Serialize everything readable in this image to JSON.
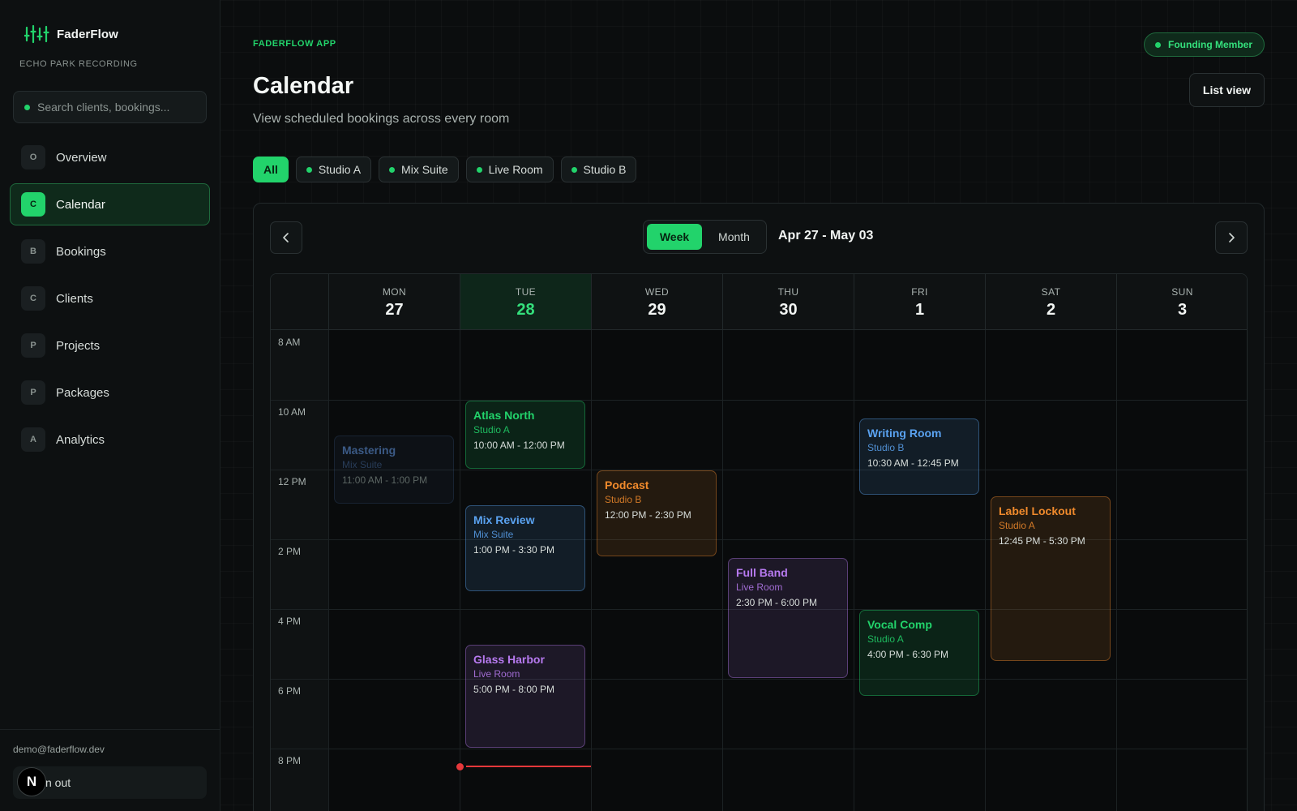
{
  "sidebar": {
    "brand": "FaderFlow",
    "studio": "ECHO PARK RECORDING",
    "search_placeholder": "Search clients, bookings...",
    "items": [
      {
        "badge": "O",
        "label": "Overview"
      },
      {
        "badge": "C",
        "label": "Calendar",
        "active": true
      },
      {
        "badge": "B",
        "label": "Bookings"
      },
      {
        "badge": "C",
        "label": "Clients"
      },
      {
        "badge": "P",
        "label": "Projects"
      },
      {
        "badge": "P",
        "label": "Packages"
      },
      {
        "badge": "A",
        "label": "Analytics"
      }
    ],
    "email": "demo@faderflow.dev",
    "signout": "n out",
    "avatar": "N"
  },
  "header": {
    "eyebrow": "FADERFLOW APP",
    "member_badge": "Founding Member",
    "title": "Calendar",
    "subtitle": "View scheduled bookings across every room",
    "list_view": "List view"
  },
  "filters": [
    "All",
    "Studio A",
    "Mix Suite",
    "Live Room",
    "Studio B"
  ],
  "calendar": {
    "view_week": "Week",
    "view_month": "Month",
    "range": "Apr 27 - May 03",
    "days": [
      {
        "dow": "MON",
        "num": "27"
      },
      {
        "dow": "TUE",
        "num": "28",
        "today": true
      },
      {
        "dow": "WED",
        "num": "29"
      },
      {
        "dow": "THU",
        "num": "30"
      },
      {
        "dow": "FRI",
        "num": "1"
      },
      {
        "dow": "SAT",
        "num": "2"
      },
      {
        "dow": "SUN",
        "num": "3"
      }
    ],
    "hours": [
      "8 AM",
      "10 AM",
      "12 PM",
      "2 PM",
      "4 PM",
      "6 PM",
      "8 PM"
    ],
    "events": [
      {
        "title": "Mastering",
        "room": "Mix Suite",
        "time": "11:00 AM - 1:00 PM",
        "day": 0,
        "start": 11,
        "end": 13,
        "color": "#3b5a86",
        "faded": true
      },
      {
        "title": "Atlas North",
        "room": "Studio A",
        "time": "10:00 AM - 12:00 PM",
        "day": 1,
        "start": 10,
        "end": 12,
        "color": "#22d36b"
      },
      {
        "title": "Mix Review",
        "room": "Mix Suite",
        "time": "1:00 PM - 3:30 PM",
        "day": 1,
        "start": 13,
        "end": 15.5,
        "color": "#5aa2f0"
      },
      {
        "title": "Glass Harbor",
        "room": "Live Room",
        "time": "5:00 PM - 8:00 PM",
        "day": 1,
        "start": 17,
        "end": 20,
        "color": "#b77af0"
      },
      {
        "title": "Podcast",
        "room": "Studio B",
        "time": "12:00 PM - 2:30 PM",
        "day": 2,
        "start": 12,
        "end": 14.5,
        "color": "#f08a2c"
      },
      {
        "title": "Full Band",
        "room": "Live Room",
        "time": "2:30 PM - 6:00 PM",
        "day": 3,
        "start": 14.5,
        "end": 18,
        "color": "#b77af0"
      },
      {
        "title": "Writing Room",
        "room": "Studio B",
        "time": "10:30 AM - 12:45 PM",
        "day": 4,
        "start": 10.5,
        "end": 12.75,
        "color": "#5aa2f0"
      },
      {
        "title": "Vocal Comp",
        "room": "Studio A",
        "time": "4:00 PM - 6:30 PM",
        "day": 4,
        "start": 16,
        "end": 18.5,
        "color": "#22d36b"
      },
      {
        "title": "Label Lockout",
        "room": "Studio A",
        "time": "12:45 PM - 5:30 PM",
        "day": 5,
        "start": 12.75,
        "end": 17.5,
        "color": "#f08a2c"
      }
    ],
    "now": {
      "day": 1,
      "hour": 20.5
    },
    "colors": {
      "accent": "#22d36b",
      "now": "#e5383b"
    }
  }
}
